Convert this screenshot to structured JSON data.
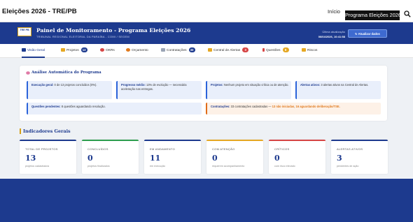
{
  "topbar": {
    "site_title": "Eleições 2026 - TRE/PB",
    "nav_home": "Início",
    "nav_active": "Programa Eleições 2026",
    "search_icon": "search-icon"
  },
  "header": {
    "logo_text": "TRE PB",
    "title": "Painel de Monitoramento - Programa Eleições 2026",
    "subtitle": "TRIBUNAL REGIONAL ELEITORAL DA PARAÍBA - COMI / SEGEM",
    "update_label": "Última atualização",
    "update_date": "06/04/2026, 10:41:58",
    "refresh_label": "Atualizar dados",
    "refresh_icon": "refresh-icon"
  },
  "tabs": [
    {
      "label": "Visão Geral",
      "icon": "grid-icon",
      "badge": ""
    },
    {
      "label": "Projetos",
      "icon": "folder-icon",
      "badge": "13"
    },
    {
      "label": "OKRs",
      "icon": "target-icon",
      "badge": ""
    },
    {
      "label": "Orçamento",
      "icon": "money-icon",
      "badge": ""
    },
    {
      "label": "Contratações",
      "icon": "document-icon",
      "badge": "33"
    },
    {
      "label": "Central de Alertas",
      "icon": "bell-icon",
      "badge": "3"
    },
    {
      "label": "Questões",
      "icon": "question-icon",
      "badge": "8"
    },
    {
      "label": "Riscos",
      "icon": "warning-icon",
      "badge": ""
    }
  ],
  "analysis": {
    "title": "Análise Automática do Programa",
    "icon": "brain-icon",
    "cards": [
      {
        "key": "Execução geral:",
        "text": "0 de 13 projetos concluídos (0%)."
      },
      {
        "key": "Progresso médio:",
        "text": "13% de evolução — necessária aceleração nas entregas."
      },
      {
        "key": "Projetos:",
        "text": "Nenhum projeto em situação crítica ou de atenção."
      },
      {
        "key": "Alertas ativos:",
        "text": "3 alertas ativos na Central de Alertas."
      },
      {
        "key": "Questões pendentes:",
        "text": "8 questões aguardando resolução."
      },
      {
        "key": "Contratações:",
        "text": "33 contratações cadastradas — ",
        "hl1": "13 não iniciadas",
        "sep": ", ",
        "hl2": "16 aguardando deliberação/TSE."
      }
    ]
  },
  "indicators": {
    "title": "Indicadores Gerais",
    "cards": [
      {
        "label": "TOTAL DE PROJETOS",
        "value": "13",
        "desc": "projetos cadastrados",
        "color": "#1d3a8e"
      },
      {
        "label": "CONCLUÍDOS",
        "value": "0",
        "desc": "projetos finalizados",
        "color": "#2e9e4f"
      },
      {
        "label": "EM ANDAMENTO",
        "value": "11",
        "desc": "em execução",
        "color": "#1d3a8e"
      },
      {
        "label": "COM ATENÇÃO",
        "value": "0",
        "desc": "requerem acompanhamento",
        "color": "#e5a823"
      },
      {
        "label": "CRÍTICOS",
        "value": "0",
        "desc": "com risco elevado",
        "color": "#d64545"
      },
      {
        "label": "ALERTAS ATIVOS",
        "value": "3",
        "desc": "pendentes de ação",
        "color": "#1d3a8e"
      }
    ]
  },
  "colors": {
    "brand": "#1d3a8e",
    "accent": "#d4a017",
    "badge_blue": "#1d3a8e",
    "badge_red": "#d64545",
    "badge_orange": "#e5a823",
    "warning": "#e0791c"
  }
}
